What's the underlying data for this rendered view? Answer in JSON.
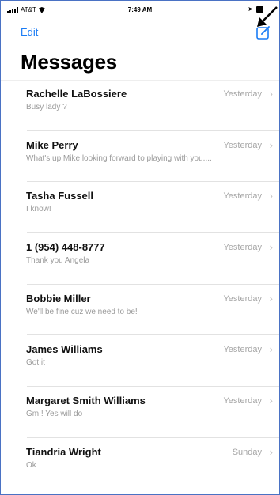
{
  "status_bar": {
    "carrier": "AT&T",
    "time": "7:49 AM"
  },
  "nav": {
    "edit_label": "Edit",
    "title": "Messages"
  },
  "conversations": [
    {
      "name": "Rachelle LaBossiere",
      "preview": "Busy lady ?",
      "date": "Yesterday"
    },
    {
      "name": "Mike Perry",
      "preview": "What's up Mike looking forward to playing with you....",
      "date": "Yesterday"
    },
    {
      "name": "Tasha Fussell",
      "preview": "I know!",
      "date": "Yesterday"
    },
    {
      "name": "1 (954) 448-8777",
      "preview": "Thank you Angela",
      "date": "Yesterday"
    },
    {
      "name": "Bobbie Miller",
      "preview": "We'll be fine cuz we need to be!",
      "date": "Yesterday"
    },
    {
      "name": "James Williams",
      "preview": "Got it",
      "date": "Yesterday"
    },
    {
      "name": "Margaret Smith Williams",
      "preview": "Gm ! Yes will do",
      "date": "Yesterday"
    },
    {
      "name": "Tiandria Wright",
      "preview": "Ok",
      "date": "Sunday"
    }
  ],
  "colors": {
    "accent": "#1a7cf5",
    "frame_border": "#4a72c4"
  },
  "icons": {
    "compose": "compose-icon",
    "chevron": "chevron-right-icon"
  }
}
